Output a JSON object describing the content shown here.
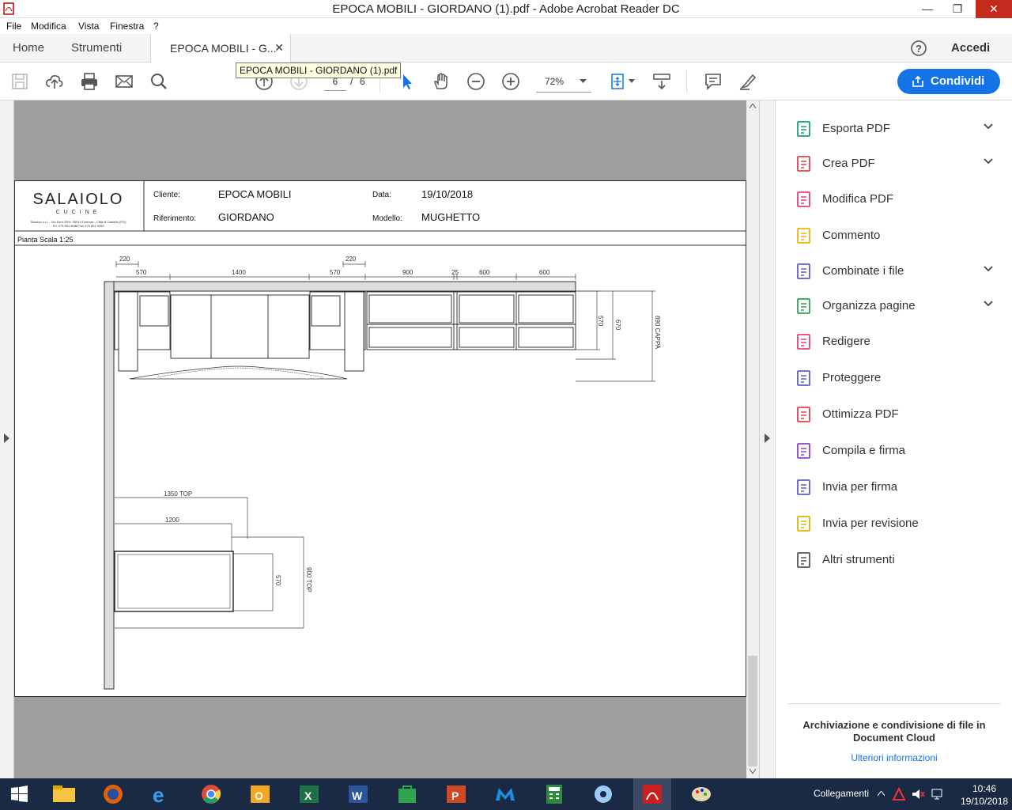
{
  "window": {
    "title": "EPOCA MOBILI - GIORDANO (1).pdf - Adobe Acrobat Reader DC"
  },
  "menu": [
    "File",
    "Modifica",
    "Vista",
    "Finestra",
    "?"
  ],
  "tabs": {
    "home": "Home",
    "tools": "Strumenti",
    "doc": "EPOCA MOBILI - G...",
    "sign_in": "Accedi"
  },
  "tooltip": "EPOCA MOBILI - GIORDANO (1).pdf",
  "toolbar": {
    "page_current": "6",
    "page_sep": "/",
    "page_total": "6",
    "zoom": "72%",
    "share_label": "Condividi"
  },
  "document": {
    "brand": "SALAIOLO",
    "brand_sub": "CUCINE",
    "brand_address": "Salaiolo s.r.l. - Via Kant 29/H, 06013 Cerbara - Città di Castello (PG)",
    "brand_phone": "Tel. 075 851 8088 Fax 075 851 9259",
    "cliente_label": "Cliente:",
    "cliente": "EPOCA MOBILI",
    "data_label": "Data:",
    "data": "19/10/2018",
    "riferimento_label": "Riferimento:",
    "riferimento": "GIORDANO",
    "modello_label": "Modello:",
    "modello": "MUGHETTO",
    "pianta": "Pianta  Scala 1:25",
    "dims": {
      "d220a": "220",
      "d570a": "570",
      "d1400": "1400",
      "d220b": "220",
      "d570b": "570",
      "d900": "900",
      "d25": "25",
      "d600a": "600",
      "d600b": "600",
      "v570": "570",
      "v670": "670",
      "v890": "890  CAPPA",
      "top1350": "1350  TOP",
      "top1200": "1200",
      "isl570": "570",
      "isl900": "900  TOP"
    }
  },
  "tools": [
    {
      "label": "Esporta PDF",
      "icon": "export-pdf-icon",
      "color": "#1b9e77",
      "expand": true
    },
    {
      "label": "Crea PDF",
      "icon": "create-pdf-icon",
      "color": "#e0404a",
      "expand": true
    },
    {
      "label": "Modifica PDF",
      "icon": "edit-pdf-icon",
      "color": "#e0407a",
      "expand": false
    },
    {
      "label": "Commento",
      "icon": "comment-icon",
      "color": "#f2b400",
      "expand": false
    },
    {
      "label": "Combinate i file",
      "icon": "combine-files-icon",
      "color": "#5b5fc7",
      "expand": true
    },
    {
      "label": "Organizza pagine",
      "icon": "organize-pages-icon",
      "color": "#2ea44f",
      "expand": true
    },
    {
      "label": "Redigere",
      "icon": "redact-icon",
      "color": "#e0407a",
      "expand": false
    },
    {
      "label": "Proteggere",
      "icon": "protect-icon",
      "color": "#5b5fc7",
      "expand": false
    },
    {
      "label": "Ottimizza PDF",
      "icon": "optimize-pdf-icon",
      "color": "#e0404a",
      "expand": false
    },
    {
      "label": "Compila e firma",
      "icon": "fill-sign-icon",
      "color": "#8e44c7",
      "expand": false
    },
    {
      "label": "Invia per firma",
      "icon": "send-for-signature-icon",
      "color": "#5b5fc7",
      "expand": false
    },
    {
      "label": "Invia per revisione",
      "icon": "send-for-review-icon",
      "color": "#e0b400",
      "expand": false
    },
    {
      "label": "Altri strumenti",
      "icon": "more-tools-icon",
      "color": "#555555",
      "expand": false
    }
  ],
  "cloud": {
    "title": "Archiviazione e condivisione di file in Document Cloud",
    "link": "Ulteriori informazioni"
  },
  "taskbar": {
    "network": "Collegamenti",
    "time": "10:46",
    "date": "19/10/2018"
  }
}
